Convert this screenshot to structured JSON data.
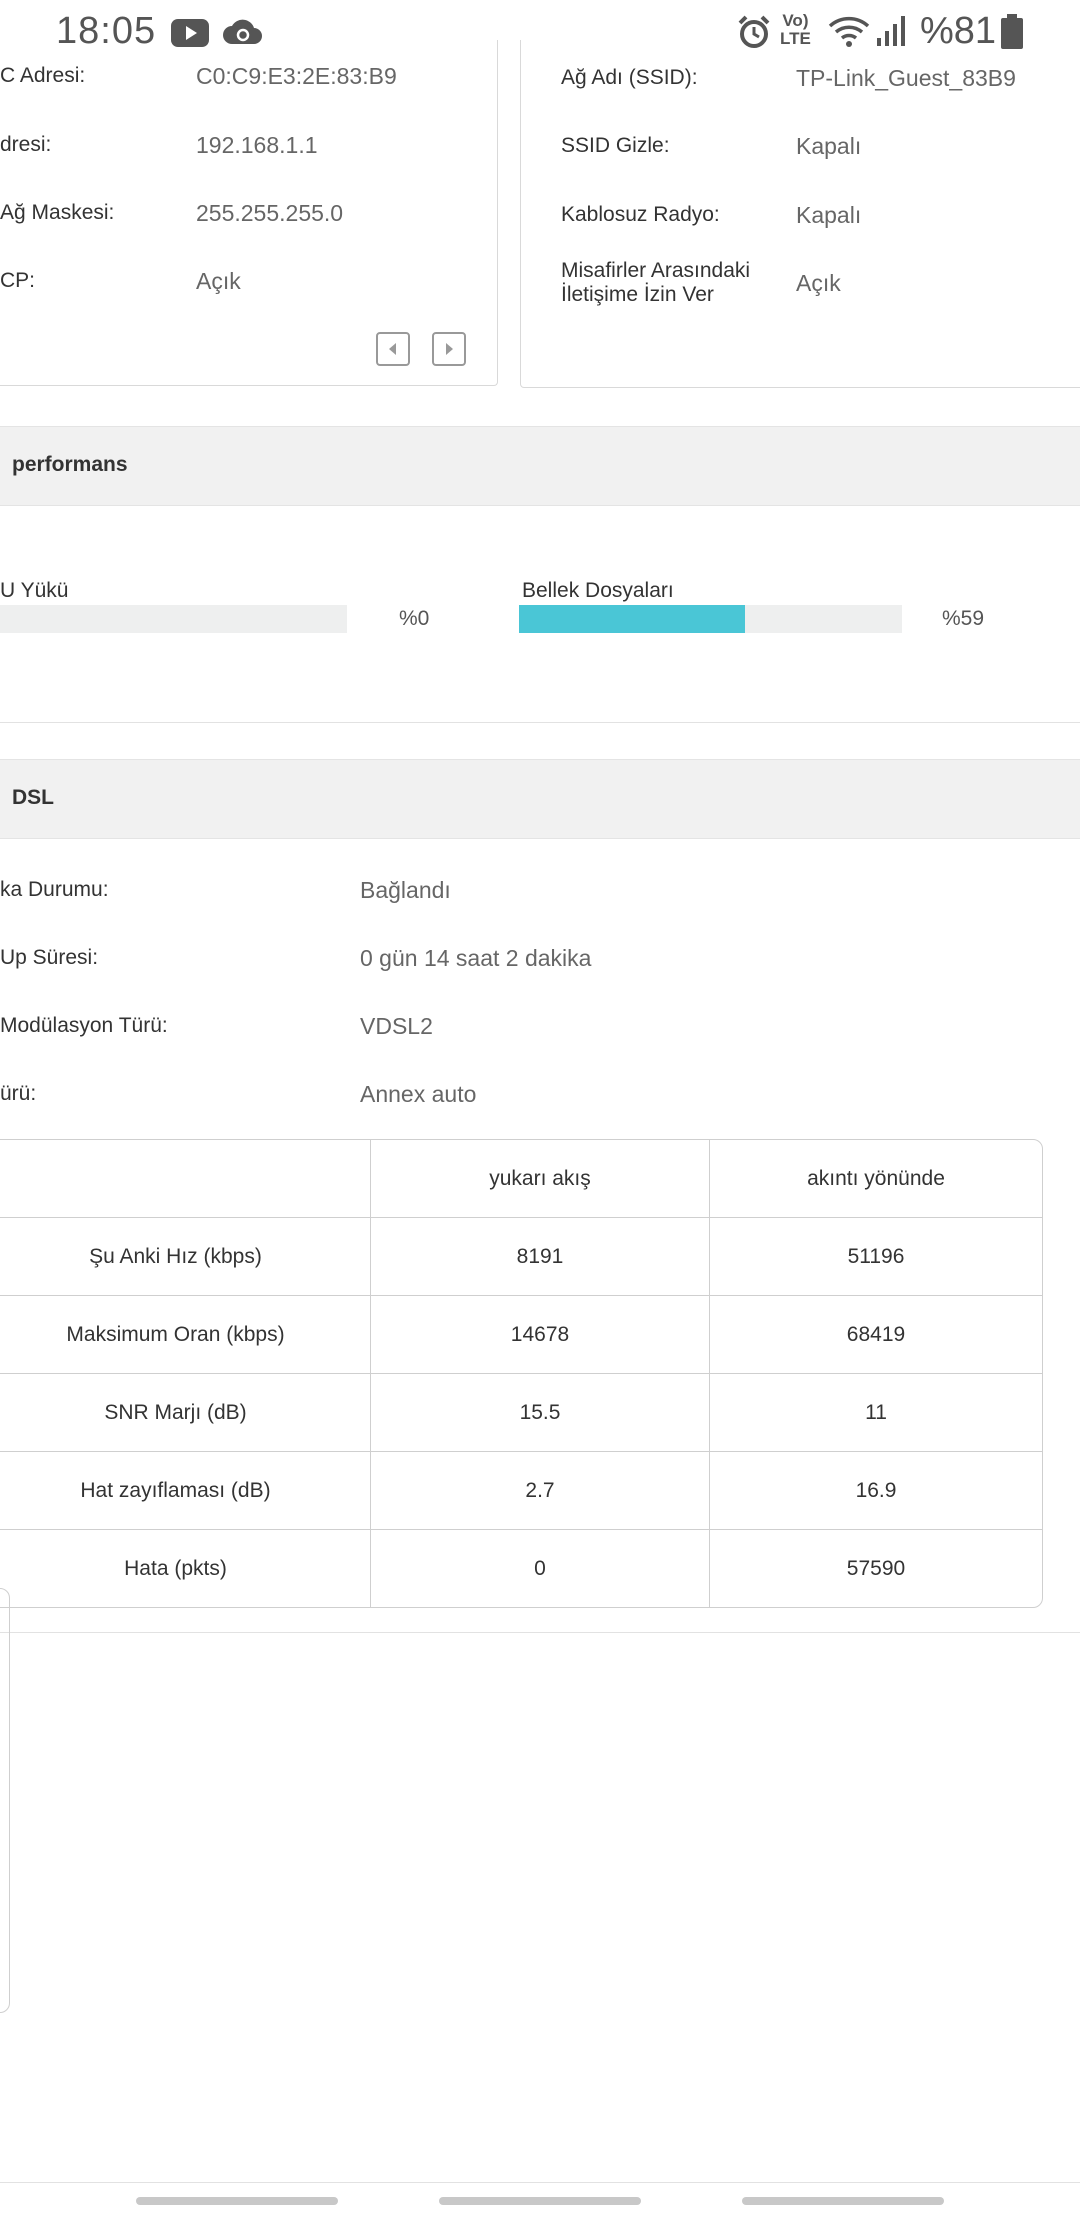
{
  "status_bar": {
    "time": "18:05",
    "net_label_1": "Vo)",
    "net_label_2": "LTE",
    "battery_percent": "%81",
    "icons": [
      "youtube-icon",
      "cloud-sync-icon",
      "alarm-icon",
      "volte-icon",
      "wifi-icon",
      "signal-icon",
      "battery-icon"
    ]
  },
  "lan_panel": {
    "rows": [
      {
        "label": "C Adresi:",
        "value": "C0:C9:E3:2E:83:B9"
      },
      {
        "label": "dresi:",
        "value": "192.168.1.1"
      },
      {
        "label": "Ağ Maskesi:",
        "value": "255.255.255.0"
      },
      {
        "label": "CP:",
        "value": "Açık"
      }
    ]
  },
  "guest_panel": {
    "rows": [
      {
        "label": "Ağ Adı (SSID):",
        "value": "TP-Link_Guest_83B9"
      },
      {
        "label": "SSID Gizle:",
        "value": "Kapalı"
      },
      {
        "label": "Kablosuz Radyo:",
        "value": "Kapalı"
      },
      {
        "label_line1": "Misafirler Arasındaki",
        "label_line2": "İletişime İzin Ver",
        "value": "Açık"
      }
    ]
  },
  "performance": {
    "title": "performans",
    "cpu": {
      "label": "U Yükü",
      "percent_text": "%0",
      "value": 0
    },
    "memory": {
      "label": "Bellek Dosyaları",
      "percent_text": "%59",
      "value": 59
    },
    "bar_color": "#4ac6d6"
  },
  "dsl": {
    "title": "DSL",
    "rows": [
      {
        "label": "ka Durumu:",
        "value": "Bağlandı"
      },
      {
        "label": " Up Süresi:",
        "value": "0 gün 14 saat 2 dakika"
      },
      {
        "label": " Modülasyon Türü:",
        "value": "VDSL2"
      },
      {
        "label": "ürü:",
        "value": "Annex auto"
      }
    ],
    "table": {
      "headers": [
        "",
        "yukarı akış",
        "akıntı yönünde"
      ],
      "rows": [
        [
          "Şu Anki Hız (kbps)",
          "8191",
          "51196"
        ],
        [
          "Maksimum Oran (kbps)",
          "14678",
          "68419"
        ],
        [
          "SNR Marjı (dB)",
          "15.5",
          "11"
        ],
        [
          "Hat zayıflaması (dB)",
          "2.7",
          "16.9"
        ],
        [
          "Hata (pkts)",
          "0",
          "57590"
        ]
      ]
    }
  }
}
